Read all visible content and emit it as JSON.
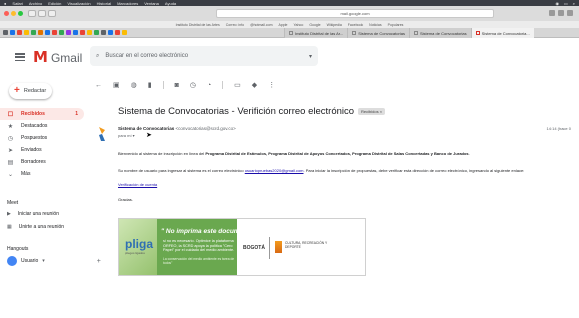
{
  "menubar": {
    "items": [
      "Safari",
      "Archivo",
      "Edición",
      "Visualización",
      "Historial",
      "Marcadores",
      "Ventana",
      "Ayuda"
    ]
  },
  "chrome": {
    "address": "mail.google.com",
    "bookmarks": [
      "Instituto Distrital de las Artes",
      "Correo: info",
      "@hotmail.com",
      "Apple",
      "Yahoo",
      "Google",
      "Wikipedia",
      "Facebook",
      "Noticias",
      "Populares"
    ],
    "tabs": [
      {
        "label": "Instituto Distrital de las Ar...",
        "active": false
      },
      {
        "label": "Sistema de Convocatorias",
        "active": false
      },
      {
        "label": "Sistema de Convocatorias",
        "active": false
      },
      {
        "label": "Sistema de Convocatoria...",
        "active": true
      }
    ]
  },
  "header": {
    "logo_text": "Gmail",
    "search_placeholder": "Buscar en el correo electrónico"
  },
  "compose_label": "Redactar",
  "sidebar": {
    "items": [
      {
        "icon": "inbox-icon",
        "glyph": "☐",
        "label": "Recibidos",
        "count": "1",
        "active": true
      },
      {
        "icon": "star-icon",
        "glyph": "★",
        "label": "Destacados",
        "count": "",
        "active": false
      },
      {
        "icon": "clock-icon",
        "glyph": "◷",
        "label": "Pospuestos",
        "count": "",
        "active": false
      },
      {
        "icon": "sent-icon",
        "glyph": "➤",
        "label": "Enviados",
        "count": "",
        "active": false
      },
      {
        "icon": "draft-icon",
        "glyph": "▤",
        "label": "Borradores",
        "count": "",
        "active": false
      },
      {
        "icon": "chevron-down-icon",
        "glyph": "⌄",
        "label": "Más",
        "count": "",
        "active": false
      }
    ],
    "meet": {
      "title": "Meet",
      "items": [
        {
          "icon": "video-icon",
          "glyph": "▶",
          "label": "Iniciar una reunión"
        },
        {
          "icon": "keyboard-icon",
          "glyph": "▦",
          "label": "Unirte a una reunión"
        }
      ]
    },
    "hangouts": {
      "title": "Hangouts",
      "user": "Usuario"
    }
  },
  "message": {
    "subject": "Sistema de Convocatorias - Verifición correo electrónico",
    "label": "Recibidos ×",
    "sender_name": "Sistema de Convocatorias",
    "sender_email": "<convocatorias@scrd.gov.co>",
    "to": "para mí ▾",
    "date": "14:14 (hace 0",
    "body": {
      "line1_prefix": "Bienvenido al sistema de inscripción en línea del ",
      "line1_bold": "Programa Distrital de Estímulos, Programa Distrital de Apoyos Concertados, Programa Distrital de Salas Concertadas y Banco de Jurados",
      "line1_suffix": ".",
      "line2_prefix": "Su nombre de usuario para ingresar al sistema es el correo electrónico ",
      "line2_link": "usuariopruebas2020@gmail.com",
      "line2_suffix": ". Para iniciar la inscripción de propuestas, debe verificar esta dirección de correo electrónico, ingresando al siguiente enlace:",
      "verify_link": "Verificación de cuenta",
      "thanks": "Gracias."
    },
    "banner": {
      "brand": "pliga",
      "brand_sub": "pliegos ligados",
      "title": "\" No imprima este documento",
      "text": "si no es necesario. Optimice la plataforma ORFEO, la SCRD apoya la política \"Cero Papel\" por el cuidado del medio ambiente.",
      "footer": "La conservación del medio ambiente es tarea de todos\"",
      "bogota": "BOGOTÁ",
      "secretaria": "CULTURA, RECREACIÓN Y DEPORTE"
    }
  }
}
